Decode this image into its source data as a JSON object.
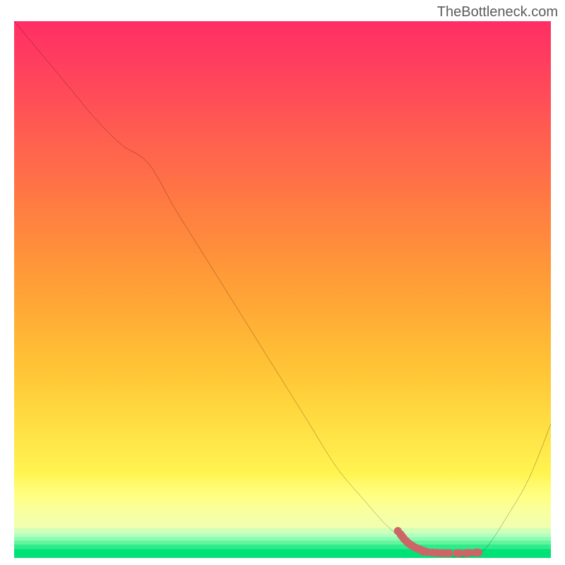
{
  "watermark": "TheBottleneck.com",
  "chart_data": {
    "type": "line",
    "title": "",
    "xlabel": "",
    "ylabel": "",
    "xlim": [
      0,
      100
    ],
    "ylim": [
      0,
      100
    ],
    "grid": false,
    "legend": false,
    "background": {
      "type": "vertical_rainbow_gradient",
      "description": "Red at top through orange/yellow to green at bottom, representing bottleneck severity"
    },
    "series": [
      {
        "name": "bottleneck-curve",
        "color": "#000000",
        "x": [
          0,
          5,
          10,
          15,
          20,
          25,
          30,
          35,
          40,
          45,
          50,
          55,
          60,
          65,
          70,
          75,
          80,
          85,
          88,
          92,
          96,
          100
        ],
        "values": [
          100,
          94,
          88,
          82,
          77,
          73.5,
          65,
          57,
          49,
          41,
          33,
          25,
          17,
          11,
          5.5,
          2,
          0.5,
          0.3,
          2,
          8,
          15,
          25
        ]
      }
    ],
    "marker_points": {
      "name": "highlight-dots",
      "color": "#cc6666",
      "x": [
        71.5,
        72,
        72.3,
        72.6,
        73,
        73.4,
        73.8,
        74.3,
        74.8,
        75.3,
        75.8,
        76.3,
        76.2,
        77,
        78,
        78.8,
        79.5,
        80.3,
        81,
        82.5,
        83,
        84.2,
        84.8,
        86,
        86.5
      ],
      "y": [
        5.0,
        4.4,
        4.0,
        3.6,
        3.2,
        2.8,
        2.5,
        2.2,
        1.9,
        1.7,
        1.5,
        1.3,
        1.2,
        1.1,
        1.0,
        0.95,
        0.9,
        0.9,
        0.9,
        0.9,
        0.9,
        0.9,
        0.95,
        1.0,
        1.0
      ]
    }
  }
}
